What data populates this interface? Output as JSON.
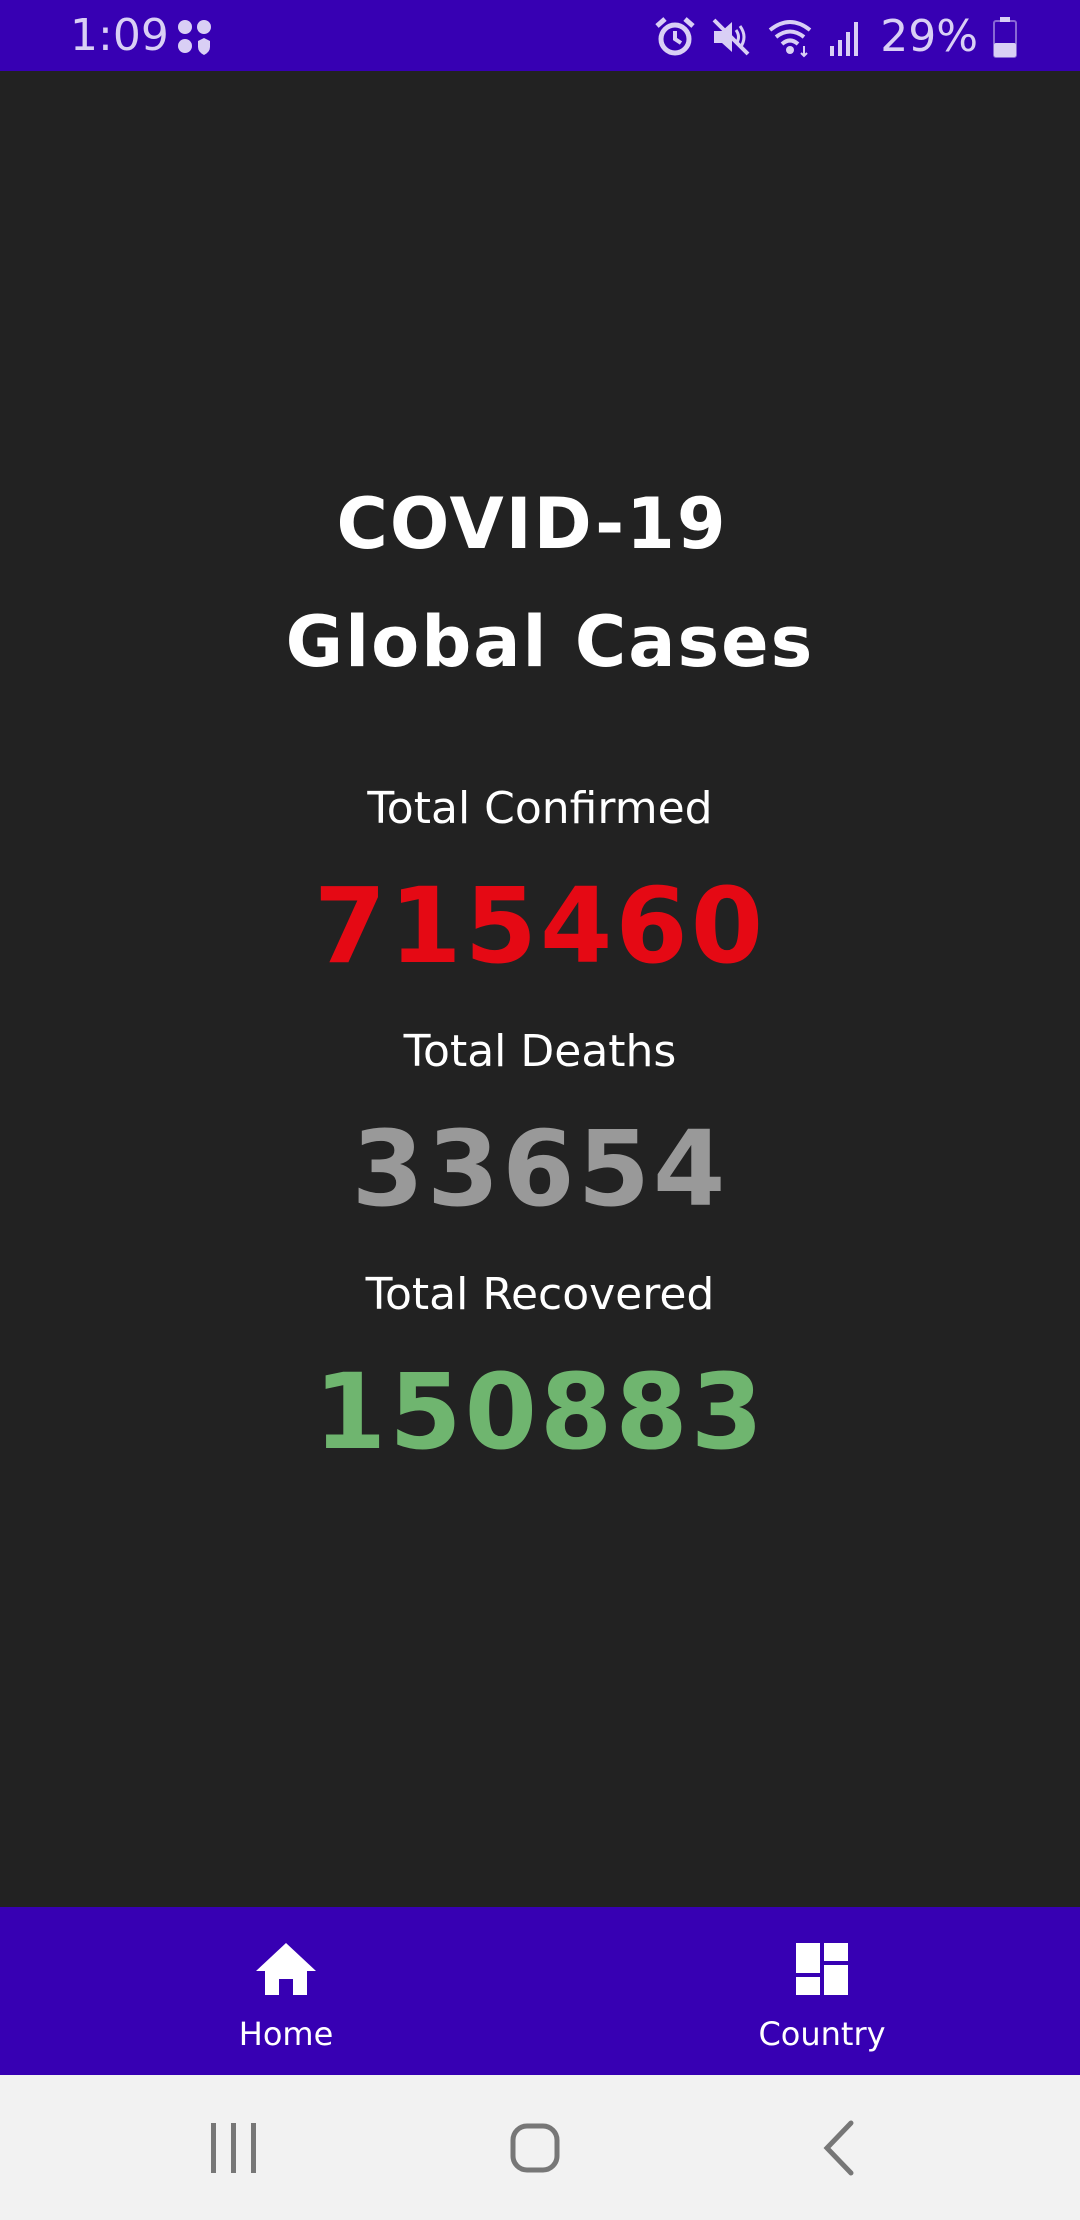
{
  "status_bar": {
    "time": "1:09",
    "battery": "29%",
    "background_color": "#3700b3",
    "icons": [
      "apps-icon",
      "alarm-icon",
      "mute-icon",
      "wifi-icon",
      "signal-icon",
      "battery-icon"
    ]
  },
  "main": {
    "title_line1": "COVID-19",
    "title_line2": "Global Cases",
    "stats": {
      "confirmed": {
        "label": "Total Confirmed",
        "value": "715460",
        "color": "#e50914"
      },
      "deaths": {
        "label": "Total Deaths",
        "value": "33654",
        "color": "#999999"
      },
      "recovered": {
        "label": "Total Recovered",
        "value": "150883",
        "color": "#6fb56f"
      }
    }
  },
  "bottom_nav": {
    "background_color": "#3700b3",
    "items": [
      {
        "label": "Home",
        "icon": "home-icon"
      },
      {
        "label": "Country",
        "icon": "dashboard-icon"
      }
    ]
  },
  "system_nav": {
    "icons": [
      "recents-icon",
      "home-circle-icon",
      "back-icon"
    ]
  }
}
